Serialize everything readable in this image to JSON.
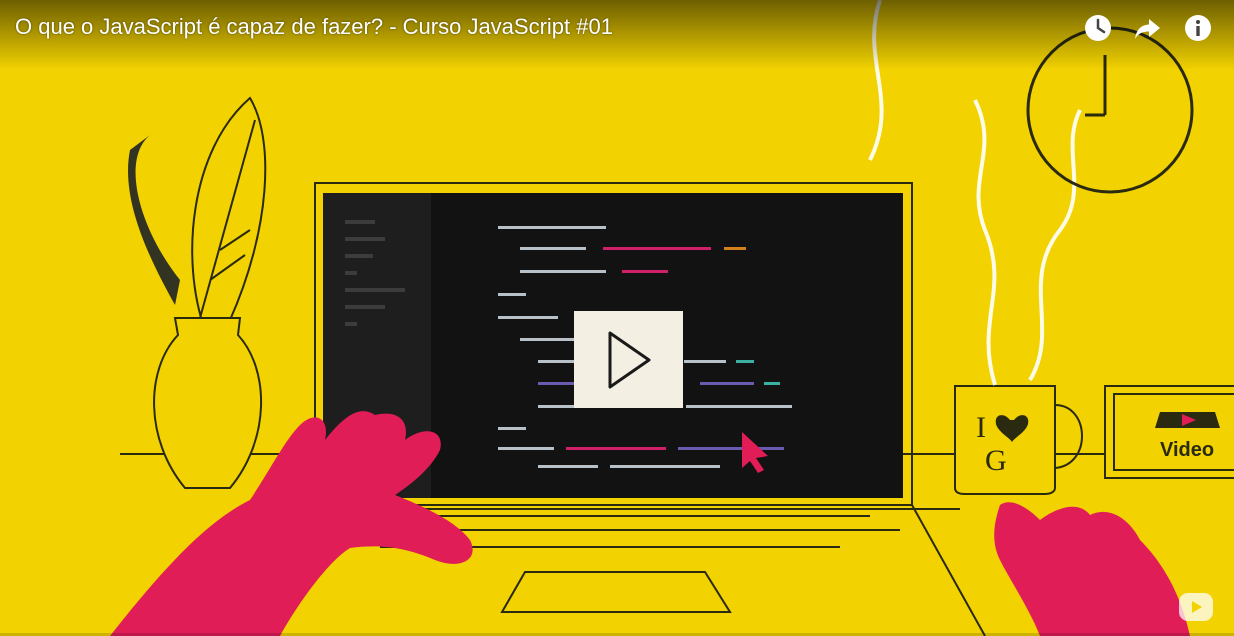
{
  "video": {
    "title": "O que o JavaScript é capaz de fazer? - Curso JavaScript #01",
    "progress_fraction": 0.0
  },
  "actions": {
    "watch_later_icon": "clock-icon",
    "share_icon": "share-arrow-icon",
    "info_icon": "info-icon"
  },
  "artwork": {
    "mug_text_line1": "I",
    "mug_text_line2": "G",
    "sign_text": "Video"
  },
  "colors": {
    "background": "#f2d200",
    "hands": "#e01d57",
    "screen": "#121212",
    "play_button": "#f3efe2"
  }
}
